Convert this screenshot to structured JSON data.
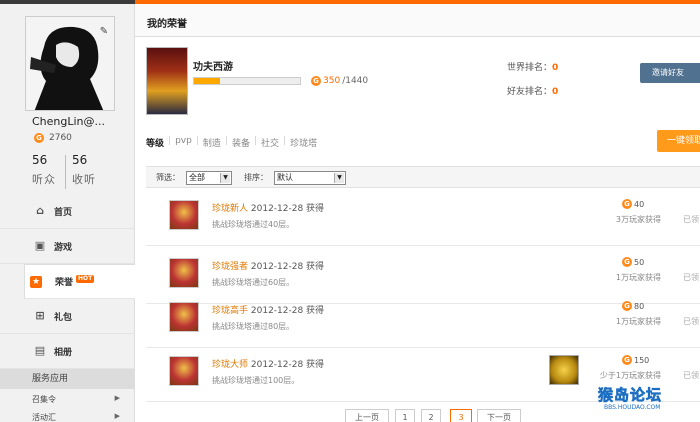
{
  "colors": {
    "accent": "#ff6a00",
    "link": "#e07800",
    "blue_button": "#50718f"
  },
  "user": {
    "name": "ChengLin@...",
    "coins": "2760",
    "listeners": "56",
    "listeners_label": "听众",
    "listening": "56",
    "listening_label": "收听"
  },
  "nav": [
    {
      "label": "首页",
      "icon": "home-icon"
    },
    {
      "label": "游戏",
      "icon": "gamepad-icon"
    },
    {
      "label": "荣誉",
      "icon": "star-icon",
      "badge": "HOT",
      "active": true
    },
    {
      "label": "礼包",
      "icon": "gift-icon"
    },
    {
      "label": "相册",
      "icon": "photo-icon"
    }
  ],
  "services": {
    "heading": "服务应用",
    "items": [
      "召集令",
      "活动汇"
    ]
  },
  "page": {
    "title": "我的荣誉"
  },
  "game": {
    "name": "功夫西游",
    "progress_current": "350",
    "progress_total": "/1440",
    "progress_fraction": 0.243,
    "world_rank_label": "世界排名：",
    "world_rank": "0",
    "friend_rank_label": "好友排名：",
    "friend_rank": "0",
    "action_button": "邀请好友",
    "one_click_button": "一键领取"
  },
  "tabs": [
    "等级",
    "pvp",
    "制造",
    "装备",
    "社交",
    "珍珑塔"
  ],
  "filters": {
    "filter_label": "筛选：",
    "filter_value": "全部",
    "sort_label": "排序：",
    "sort_value": "默认"
  },
  "achievements": [
    {
      "name": "珍珑新人",
      "date": "2012-12-28 获得",
      "desc": "挑战珍珑塔通过40层。",
      "points": "40",
      "players": "3万玩家获得",
      "status": "已领"
    },
    {
      "name": "珍珑强者",
      "date": "2012-12-28 获得",
      "desc": "挑战珍珑塔通过60层。",
      "points": "50",
      "players": "1万玩家获得",
      "status": "已领"
    },
    {
      "name": "珍珑高手",
      "date": "2012-12-28 获得",
      "desc": "挑战珍珑塔通过80层。",
      "points": "80",
      "players": "1万玩家获得",
      "status": "已领"
    },
    {
      "name": "珍珑大师",
      "date": "2012-12-28 获得",
      "desc": "挑战珍珑塔通过100层。",
      "points": "150",
      "players": "少于1万玩家获得",
      "status": "已领"
    }
  ],
  "pager": [
    "上一页",
    "1",
    "2",
    "3",
    "下一页"
  ],
  "watermark": {
    "main": "猴岛论坛",
    "sub": "BBS.HOUDAO.COM"
  }
}
